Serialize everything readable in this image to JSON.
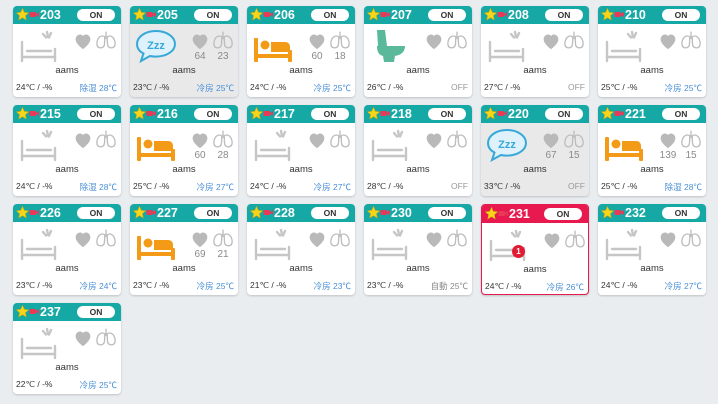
{
  "rooms": [
    {
      "number": "203",
      "toggle": "ON",
      "icon": "bed-empty-icon",
      "heart": "",
      "resp": "",
      "name": "aams",
      "temp": "24℃ / -%",
      "mode": "除湿 28℃",
      "mode_type": "blue",
      "bg": "white"
    },
    {
      "number": "205",
      "toggle": "ON",
      "icon": "sleep-bubble-icon",
      "heart": "64",
      "resp": "23",
      "name": "aams",
      "temp": "23℃ / -%",
      "mode": "冷房 25℃",
      "mode_type": "blue",
      "bg": "gray"
    },
    {
      "number": "206",
      "toggle": "ON",
      "icon": "person-in-bed-icon",
      "heart": "60",
      "resp": "18",
      "name": "aams",
      "temp": "24℃ / -%",
      "mode": "冷房 25℃",
      "mode_type": "blue",
      "bg": "white"
    },
    {
      "number": "207",
      "toggle": "ON",
      "icon": "toilet-icon",
      "heart": "",
      "resp": "",
      "name": "aams",
      "temp": "26℃ / -%",
      "mode": "OFF",
      "mode_type": "off",
      "bg": "white"
    },
    {
      "number": "208",
      "toggle": "ON",
      "icon": "bed-empty-icon",
      "heart": "",
      "resp": "",
      "name": "aams",
      "temp": "27℃ / -%",
      "mode": "OFF",
      "mode_type": "off",
      "bg": "white"
    },
    {
      "number": "210",
      "toggle": "ON",
      "icon": "bed-empty-icon",
      "heart": "",
      "resp": "",
      "name": "aams",
      "temp": "25℃ / -%",
      "mode": "冷房 25℃",
      "mode_type": "blue",
      "bg": "white"
    },
    {
      "number": "215",
      "toggle": "ON",
      "icon": "bed-empty-icon",
      "heart": "",
      "resp": "",
      "name": "aams",
      "temp": "24℃ / -%",
      "mode": "除湿 28℃",
      "mode_type": "blue",
      "bg": "white"
    },
    {
      "number": "216",
      "toggle": "ON",
      "icon": "person-in-bed-icon",
      "heart": "60",
      "resp": "28",
      "name": "aams",
      "temp": "25℃ / -%",
      "mode": "冷房 27℃",
      "mode_type": "blue",
      "bg": "white"
    },
    {
      "number": "217",
      "toggle": "ON",
      "icon": "bed-empty-icon",
      "heart": "",
      "resp": "",
      "name": "aams",
      "temp": "24℃ / -%",
      "mode": "冷房 27℃",
      "mode_type": "blue",
      "bg": "white"
    },
    {
      "number": "218",
      "toggle": "ON",
      "icon": "bed-empty-icon",
      "heart": "",
      "resp": "",
      "name": "aams",
      "temp": "28℃ / -%",
      "mode": "OFF",
      "mode_type": "off",
      "bg": "white"
    },
    {
      "number": "220",
      "toggle": "ON",
      "icon": "sleep-bubble-icon",
      "heart": "67",
      "resp": "15",
      "name": "aams",
      "temp": "33℃ / -%",
      "mode": "OFF",
      "mode_type": "off",
      "bg": "gray"
    },
    {
      "number": "221",
      "toggle": "ON",
      "icon": "person-in-bed-icon",
      "heart": "139",
      "resp": "15",
      "name": "aams",
      "temp": "25℃ / -%",
      "mode": "除湿 28℃",
      "mode_type": "blue",
      "bg": "white"
    },
    {
      "number": "226",
      "toggle": "ON",
      "icon": "bed-empty-icon",
      "heart": "",
      "resp": "",
      "name": "aams",
      "temp": "23℃ / -%",
      "mode": "冷房 24℃",
      "mode_type": "blue",
      "bg": "white"
    },
    {
      "number": "227",
      "toggle": "ON",
      "icon": "person-in-bed-icon",
      "heart": "69",
      "resp": "21",
      "name": "aams",
      "temp": "23℃ / -%",
      "mode": "冷房 25℃",
      "mode_type": "blue",
      "bg": "white"
    },
    {
      "number": "228",
      "toggle": "ON",
      "icon": "bed-empty-icon",
      "heart": "",
      "resp": "",
      "name": "aams",
      "temp": "21℃ / -%",
      "mode": "冷房 23℃",
      "mode_type": "blue",
      "bg": "white"
    },
    {
      "number": "230",
      "toggle": "ON",
      "icon": "bed-empty-icon",
      "heart": "",
      "resp": "",
      "name": "aams",
      "temp": "23℃ / -%",
      "mode": "自動 25℃",
      "mode_type": "auto",
      "bg": "white"
    },
    {
      "number": "231",
      "toggle": "ON",
      "icon": "bed-empty-icon",
      "heart": "",
      "resp": "",
      "name": "aams",
      "temp": "24℃ / -%",
      "mode": "冷房 26℃",
      "mode_type": "blue",
      "bg": "alert",
      "badge": "1"
    },
    {
      "number": "232",
      "toggle": "ON",
      "icon": "bed-empty-icon",
      "heart": "",
      "resp": "",
      "name": "aams",
      "temp": "24℃ / -%",
      "mode": "冷房 27℃",
      "mode_type": "blue",
      "bg": "white"
    },
    {
      "number": "237",
      "toggle": "ON",
      "icon": "bed-empty-icon",
      "heart": "",
      "resp": "",
      "name": "aams",
      "temp": "22℃ / -%",
      "mode": "冷房 25℃",
      "mode_type": "blue",
      "bg": "white"
    }
  ],
  "colors": {
    "header": "#16a8a4",
    "alert": "#e8194e",
    "accent_orange": "#f39a17",
    "sleep_blue": "#36a9d9",
    "toilet_green": "#5ab99a",
    "mode_blue": "#4a8fd6"
  }
}
